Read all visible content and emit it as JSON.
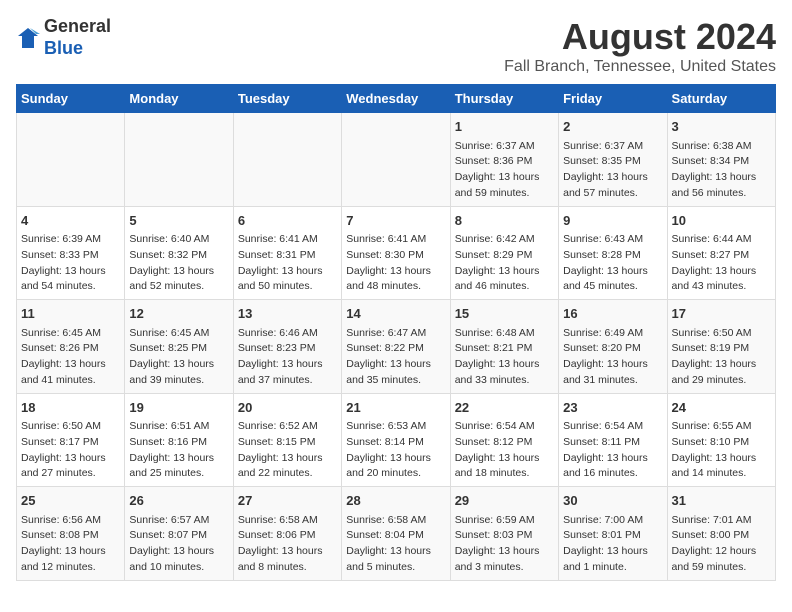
{
  "header": {
    "logo_line1": "General",
    "logo_line2": "Blue",
    "title": "August 2024",
    "subtitle": "Fall Branch, Tennessee, United States"
  },
  "days_of_week": [
    "Sunday",
    "Monday",
    "Tuesday",
    "Wednesday",
    "Thursday",
    "Friday",
    "Saturday"
  ],
  "weeks": [
    [
      {
        "day": "",
        "info": ""
      },
      {
        "day": "",
        "info": ""
      },
      {
        "day": "",
        "info": ""
      },
      {
        "day": "",
        "info": ""
      },
      {
        "day": "1",
        "info": "Sunrise: 6:37 AM\nSunset: 8:36 PM\nDaylight: 13 hours\nand 59 minutes."
      },
      {
        "day": "2",
        "info": "Sunrise: 6:37 AM\nSunset: 8:35 PM\nDaylight: 13 hours\nand 57 minutes."
      },
      {
        "day": "3",
        "info": "Sunrise: 6:38 AM\nSunset: 8:34 PM\nDaylight: 13 hours\nand 56 minutes."
      }
    ],
    [
      {
        "day": "4",
        "info": "Sunrise: 6:39 AM\nSunset: 8:33 PM\nDaylight: 13 hours\nand 54 minutes."
      },
      {
        "day": "5",
        "info": "Sunrise: 6:40 AM\nSunset: 8:32 PM\nDaylight: 13 hours\nand 52 minutes."
      },
      {
        "day": "6",
        "info": "Sunrise: 6:41 AM\nSunset: 8:31 PM\nDaylight: 13 hours\nand 50 minutes."
      },
      {
        "day": "7",
        "info": "Sunrise: 6:41 AM\nSunset: 8:30 PM\nDaylight: 13 hours\nand 48 minutes."
      },
      {
        "day": "8",
        "info": "Sunrise: 6:42 AM\nSunset: 8:29 PM\nDaylight: 13 hours\nand 46 minutes."
      },
      {
        "day": "9",
        "info": "Sunrise: 6:43 AM\nSunset: 8:28 PM\nDaylight: 13 hours\nand 45 minutes."
      },
      {
        "day": "10",
        "info": "Sunrise: 6:44 AM\nSunset: 8:27 PM\nDaylight: 13 hours\nand 43 minutes."
      }
    ],
    [
      {
        "day": "11",
        "info": "Sunrise: 6:45 AM\nSunset: 8:26 PM\nDaylight: 13 hours\nand 41 minutes."
      },
      {
        "day": "12",
        "info": "Sunrise: 6:45 AM\nSunset: 8:25 PM\nDaylight: 13 hours\nand 39 minutes."
      },
      {
        "day": "13",
        "info": "Sunrise: 6:46 AM\nSunset: 8:23 PM\nDaylight: 13 hours\nand 37 minutes."
      },
      {
        "day": "14",
        "info": "Sunrise: 6:47 AM\nSunset: 8:22 PM\nDaylight: 13 hours\nand 35 minutes."
      },
      {
        "day": "15",
        "info": "Sunrise: 6:48 AM\nSunset: 8:21 PM\nDaylight: 13 hours\nand 33 minutes."
      },
      {
        "day": "16",
        "info": "Sunrise: 6:49 AM\nSunset: 8:20 PM\nDaylight: 13 hours\nand 31 minutes."
      },
      {
        "day": "17",
        "info": "Sunrise: 6:50 AM\nSunset: 8:19 PM\nDaylight: 13 hours\nand 29 minutes."
      }
    ],
    [
      {
        "day": "18",
        "info": "Sunrise: 6:50 AM\nSunset: 8:17 PM\nDaylight: 13 hours\nand 27 minutes."
      },
      {
        "day": "19",
        "info": "Sunrise: 6:51 AM\nSunset: 8:16 PM\nDaylight: 13 hours\nand 25 minutes."
      },
      {
        "day": "20",
        "info": "Sunrise: 6:52 AM\nSunset: 8:15 PM\nDaylight: 13 hours\nand 22 minutes."
      },
      {
        "day": "21",
        "info": "Sunrise: 6:53 AM\nSunset: 8:14 PM\nDaylight: 13 hours\nand 20 minutes."
      },
      {
        "day": "22",
        "info": "Sunrise: 6:54 AM\nSunset: 8:12 PM\nDaylight: 13 hours\nand 18 minutes."
      },
      {
        "day": "23",
        "info": "Sunrise: 6:54 AM\nSunset: 8:11 PM\nDaylight: 13 hours\nand 16 minutes."
      },
      {
        "day": "24",
        "info": "Sunrise: 6:55 AM\nSunset: 8:10 PM\nDaylight: 13 hours\nand 14 minutes."
      }
    ],
    [
      {
        "day": "25",
        "info": "Sunrise: 6:56 AM\nSunset: 8:08 PM\nDaylight: 13 hours\nand 12 minutes."
      },
      {
        "day": "26",
        "info": "Sunrise: 6:57 AM\nSunset: 8:07 PM\nDaylight: 13 hours\nand 10 minutes."
      },
      {
        "day": "27",
        "info": "Sunrise: 6:58 AM\nSunset: 8:06 PM\nDaylight: 13 hours\nand 8 minutes."
      },
      {
        "day": "28",
        "info": "Sunrise: 6:58 AM\nSunset: 8:04 PM\nDaylight: 13 hours\nand 5 minutes."
      },
      {
        "day": "29",
        "info": "Sunrise: 6:59 AM\nSunset: 8:03 PM\nDaylight: 13 hours\nand 3 minutes."
      },
      {
        "day": "30",
        "info": "Sunrise: 7:00 AM\nSunset: 8:01 PM\nDaylight: 13 hours\nand 1 minute."
      },
      {
        "day": "31",
        "info": "Sunrise: 7:01 AM\nSunset: 8:00 PM\nDaylight: 12 hours\nand 59 minutes."
      }
    ]
  ]
}
